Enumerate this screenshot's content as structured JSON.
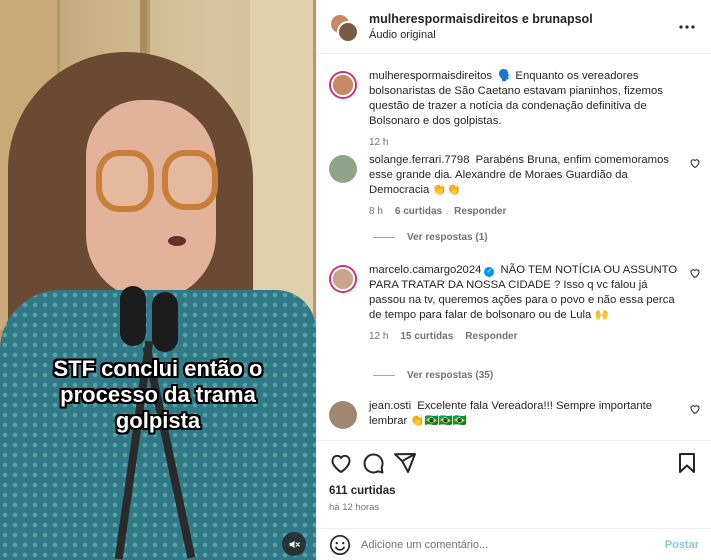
{
  "media": {
    "caption": "STF conclui então o processo da trama golpista"
  },
  "header": {
    "names": "mulherespormaisdireitos e brunapsol",
    "audio": "Áudio original"
  },
  "comments": [
    {
      "user": "mulherespormaisdireitos",
      "text": "🗣️ Enquanto os vereadores bolsonaristas de São Caetano estavam pianinhos, fizemos questão de trazer a notícia da condenação definitiva de Bolsonaro e dos golpistas.",
      "time": "12 h"
    },
    {
      "user": "solange.ferrari.7798",
      "text": "Parabéns Bruna, enfim comemoramos esse grande dia. Alexandre de Moraes Guardião da Democracia 👏👏",
      "time": "8 h",
      "likes": "6 curtidas",
      "reply": "Responder",
      "view_replies": "Ver respostas (1)"
    },
    {
      "user": "marcelo.camargo2024",
      "verified": true,
      "text": "NÃO TEM NOTÍCIA OU ASSUNTO PARA TRATAR DA NOSSA CIDADE ? Isso q vc falou já passou na tv, queremos ações para o povo e não essa perca de tempo para falar de bolsonaro ou de Lula 🙌",
      "time": "12 h",
      "likes": "15 curtidas",
      "reply": "Responder",
      "view_replies": "Ver respostas (35)"
    },
    {
      "user": "jean.osti",
      "text": "Excelente fala Vereadora!!! Sempre importante lembrar 👏🇧🇷🇧🇷🇧🇷"
    }
  ],
  "footer": {
    "likes": "611 curtidas",
    "time": "há 12 horas",
    "comment_placeholder": "Adicione um comentário...",
    "post_label": "Postar"
  },
  "colors": {
    "accent": "#0095f6",
    "secondary_text": "#737373"
  }
}
